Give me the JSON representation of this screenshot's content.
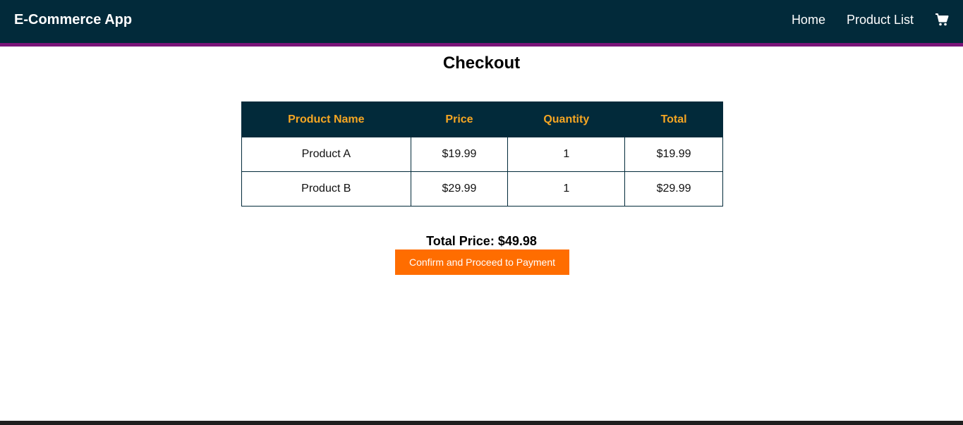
{
  "header": {
    "brand": "E-Commerce App",
    "nav": [
      {
        "label": "Home"
      },
      {
        "label": "Product List"
      }
    ],
    "cart_icon": "shopping-cart-icon"
  },
  "page": {
    "title": "Checkout"
  },
  "table": {
    "headers": [
      "Product Name",
      "Price",
      "Quantity",
      "Total"
    ],
    "rows": [
      [
        "Product A",
        "$19.99",
        "1",
        "$19.99"
      ],
      [
        "Product B",
        "$29.99",
        "1",
        "$29.99"
      ]
    ]
  },
  "summary": {
    "total_price": "Total Price: $49.98",
    "confirm_label": "Confirm and Proceed to Payment"
  },
  "colors": {
    "navbar": "#022a3a",
    "navbar_border": "#7a1479",
    "header_text": "#f5a623",
    "button": "#ff6d00"
  }
}
